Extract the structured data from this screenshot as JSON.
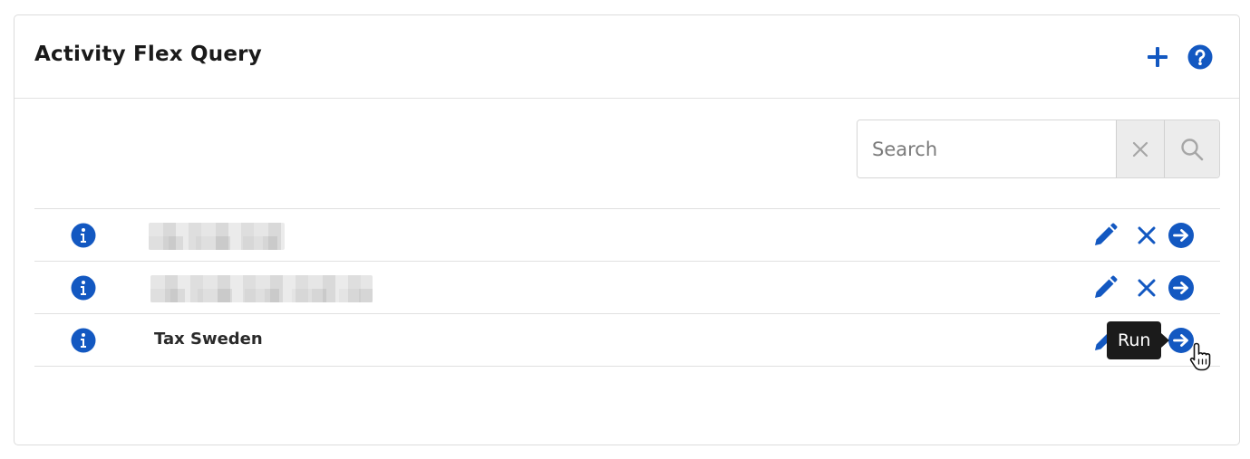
{
  "panel": {
    "title": "Activity Flex Query",
    "add_icon": "plus-icon",
    "help_icon": "question-circle-icon",
    "accent_color": "#1358c1"
  },
  "search": {
    "placeholder": "Search",
    "value": "",
    "clear_icon": "close-icon",
    "search_icon": "search-icon"
  },
  "queries": [
    {
      "name": "",
      "redacted": true,
      "info_icon": "info-circle-icon",
      "actions": [
        "pencil-icon",
        "close-icon",
        "arrow-right-circle-icon"
      ]
    },
    {
      "name": "",
      "redacted": true,
      "info_icon": "info-circle-icon",
      "actions": [
        "pencil-icon",
        "close-icon",
        "arrow-right-circle-icon"
      ]
    },
    {
      "name": "Tax Sweden",
      "redacted": false,
      "info_icon": "info-circle-icon",
      "actions": [
        "pencil-icon",
        "close-icon",
        "arrow-right-circle-icon"
      ]
    }
  ],
  "tooltip": {
    "text": "Run"
  }
}
